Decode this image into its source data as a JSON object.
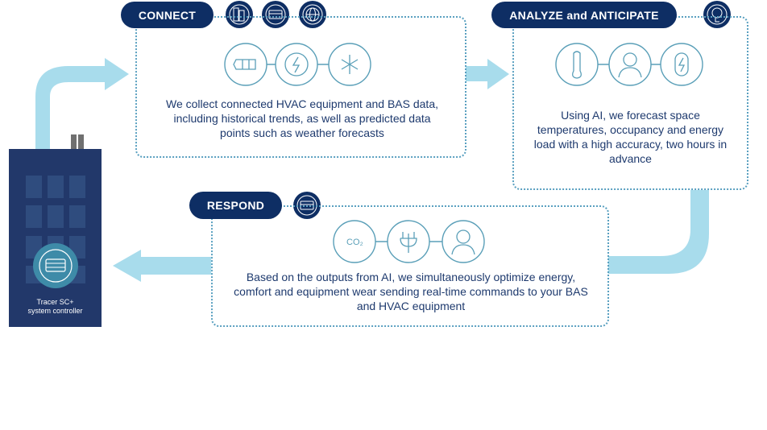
{
  "building": {
    "label_line1": "Tracer SC+",
    "label_line2": "system controller"
  },
  "connect": {
    "title": "CONNECT",
    "header_icons": [
      "building-icon",
      "controller-icon",
      "globe-icon"
    ],
    "step_icons": [
      "battery-icon",
      "energy-cycle-icon",
      "weather-icon"
    ],
    "text": "We collect connected HVAC equipment and BAS data, including historical trends, as well as predicted data points such as weather forecasts"
  },
  "analyze": {
    "title": "ANALYZE and ANTICIPATE",
    "header_icons": [
      "ai-brain-icon"
    ],
    "step_icons": [
      "thermometer-icon",
      "occupant-icon",
      "energy-load-icon"
    ],
    "text": "Using AI, we forecast space temperatures, occupancy and energy load with a high accuracy, two hours in advance"
  },
  "respond": {
    "title": "RESPOND",
    "header_icons": [
      "controller-icon"
    ],
    "step_icons": [
      "co2-icon",
      "eco-plug-icon",
      "comfort-person-icon"
    ],
    "text": "Based on the outputs from AI, we simultaneously optimize energy, comfort and equipment wear sending real-time commands to your BAS and HVAC equipment"
  },
  "colors": {
    "navy": "#0e2e64",
    "building": "#22386a",
    "arrow": "#a8dcec",
    "outline": "#5aa0c0",
    "text": "#1e3a6e"
  }
}
